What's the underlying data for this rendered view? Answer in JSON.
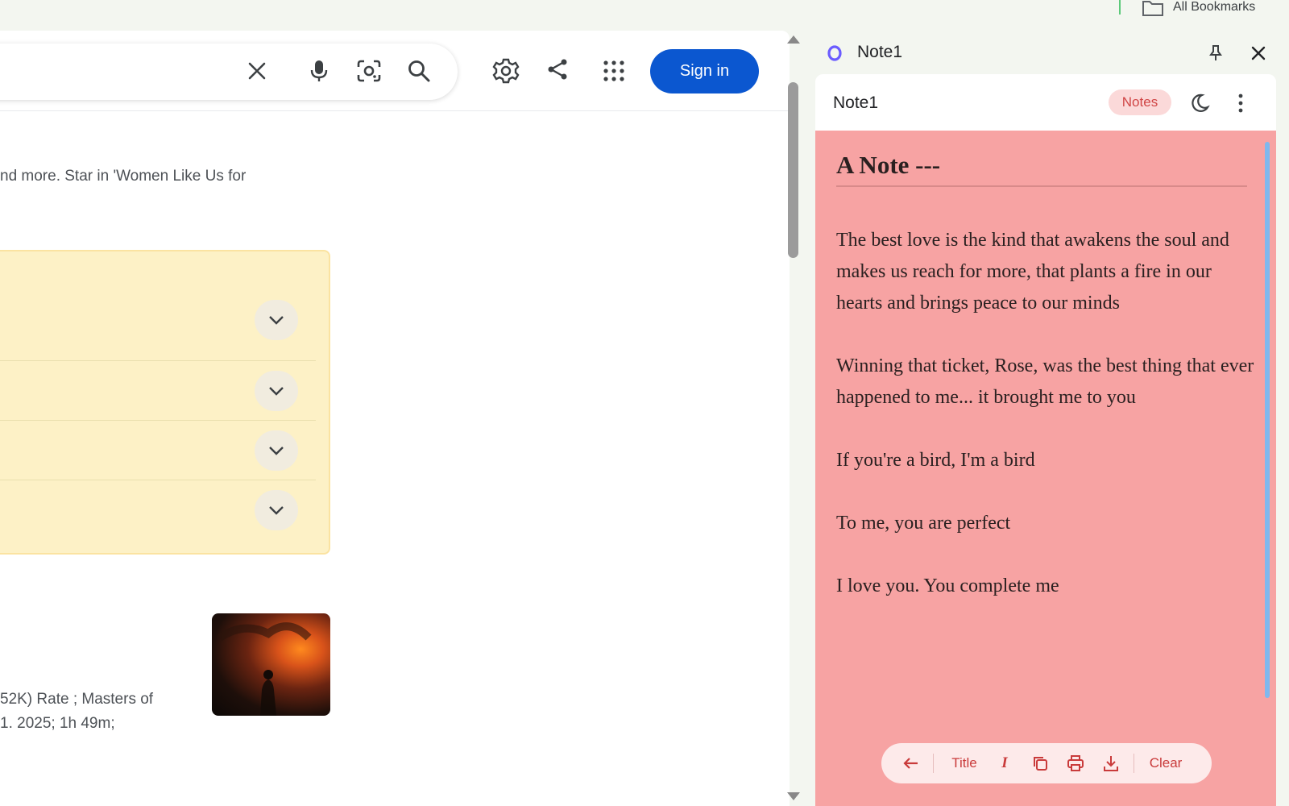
{
  "bookmarks_bar": {
    "folder_icon": "folder-icon",
    "label": "All Bookmarks"
  },
  "search_header": {
    "icons": [
      "close-icon",
      "microphone-icon",
      "lens-icon",
      "search-icon",
      "settings-icon",
      "share-icon",
      "apps-grid-icon"
    ],
    "sign_in_label": "Sign in",
    "sign_in_color": "#0b57d0"
  },
  "results": {
    "snippet_top": "nd more. Star in 'Women Like Us for",
    "faq_rows": 4,
    "faq_color": "#fdf1c6",
    "snippet_bottom": [
      "52K) Rate ; Masters of",
      "1. 2025; 1h 49m;"
    ]
  },
  "side_panel": {
    "title": "Note1",
    "extension_icon": "notes-extension-icon",
    "pin_icon": "pin-icon",
    "close_icon": "close-icon",
    "note": {
      "name": "Note1",
      "notes_pill": "Notes",
      "theme_icon": "moon-icon",
      "menu_icon": "kebab-menu-icon",
      "background_color": "#f7a3a3",
      "heading": "A Note ---",
      "paragraphs": [
        "The best love is the kind that awakens the soul and makes us reach for more, that plants a fire in our hearts and brings peace to our minds",
        "Winning that ticket, Rose, was the best thing that ever happened to me... it brought me to you",
        "If you're a bird, I'm a bird",
        "To me, you are perfect",
        "I love you. You complete me"
      ]
    },
    "toolbar": {
      "back_icon": "arrow-left-icon",
      "title_label": "Title",
      "italic_label": "I",
      "copy_icon": "copy-icon",
      "print_icon": "print-icon",
      "download_icon": "download-icon",
      "clear_label": "Clear"
    }
  }
}
